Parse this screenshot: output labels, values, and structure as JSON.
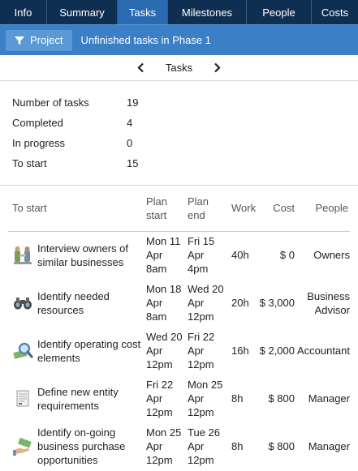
{
  "tabs": [
    {
      "label": "Info",
      "active": false
    },
    {
      "label": "Summary",
      "active": false
    },
    {
      "label": "Tasks",
      "active": true
    },
    {
      "label": "Milestones",
      "active": false
    },
    {
      "label": "People",
      "active": false
    },
    {
      "label": "Costs",
      "active": false
    }
  ],
  "filter": {
    "button_label": "Project",
    "description": "Unfinished tasks in Phase 1"
  },
  "pager": {
    "title": "Tasks"
  },
  "stats": [
    {
      "label": "Number of tasks",
      "value": "19"
    },
    {
      "label": "Completed",
      "value": "4"
    },
    {
      "label": "In progress",
      "value": "0"
    },
    {
      "label": "To start",
      "value": "15"
    }
  ],
  "table": {
    "headers": {
      "name": "To start",
      "plan_start_1": "Plan",
      "plan_start_2": "start",
      "plan_end_1": "Plan",
      "plan_end_2": "end",
      "work": "Work",
      "cost": "Cost",
      "people": "People"
    },
    "rows": [
      {
        "icon": "handshake-people-icon",
        "name_1": "Interview owners of",
        "name_2": "similar businesses",
        "start_1": "Mon 11",
        "start_2": "Apr",
        "start_3": "8am",
        "end_1": "Fri 15",
        "end_2": "Apr",
        "end_3": "4pm",
        "work": "40h",
        "cost": "$ 0",
        "people_1": "Owners",
        "people_2": ""
      },
      {
        "icon": "binoculars-icon",
        "name_1": "Identify needed",
        "name_2": "resources",
        "start_1": "Mon 18",
        "start_2": "Apr",
        "start_3": "8am",
        "end_1": "Wed 20",
        "end_2": "Apr",
        "end_3": "12pm",
        "work": "20h",
        "cost": "$ 3,000",
        "people_1": "Business",
        "people_2": "Advisor"
      },
      {
        "icon": "magnifier-money-icon",
        "name_1": "Identify operating cost",
        "name_2": "elements",
        "start_1": "Wed 20",
        "start_2": "Apr",
        "start_3": "12pm",
        "end_1": "Fri 22",
        "end_2": "Apr",
        "end_3": "12pm",
        "work": "16h",
        "cost": "$ 2,000",
        "people_1": "Accountant",
        "people_2": ""
      },
      {
        "icon": "document-icon",
        "name_1": "Define new entity",
        "name_2": "requirements",
        "start_1": "Fri 22",
        "start_2": "Apr",
        "start_3": "12pm",
        "end_1": "Mon 25",
        "end_2": "Apr",
        "end_3": "12pm",
        "work": "8h",
        "cost": "$ 800",
        "people_1": "Manager",
        "people_2": ""
      },
      {
        "icon": "hand-money-icon",
        "name_1": "Identify on-going",
        "name_2": "business purchase",
        "name_3": "opportunities",
        "start_1": "Mon 25",
        "start_2": "Apr",
        "start_3": "12pm",
        "end_1": "Tue 26",
        "end_2": "Apr",
        "end_3": "12pm",
        "work": "8h",
        "cost": "$ 800",
        "people_1": "Manager",
        "people_2": ""
      }
    ]
  }
}
